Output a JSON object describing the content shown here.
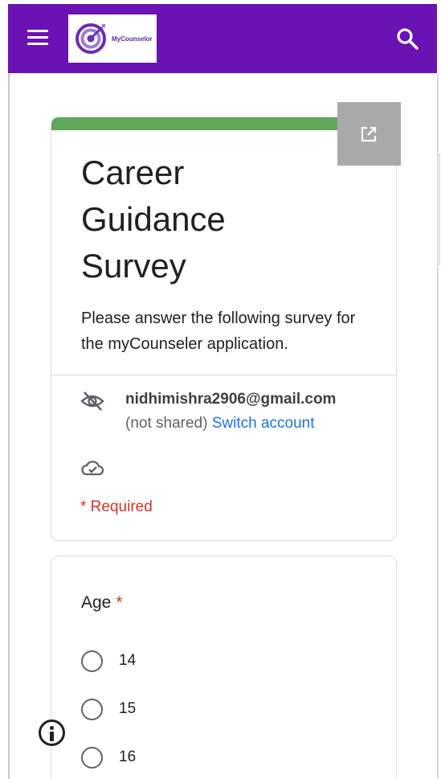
{
  "appbar": {
    "logo_text": "MyCounselor",
    "color": "#6a12b3"
  },
  "form": {
    "title": "Career Guidance Survey",
    "description": "Please answer the following survey for the myCounseler application.",
    "account_email": "nidhimishra2906@gmail.com",
    "not_shared": "(not shared)",
    "switch_account": "Switch account",
    "required_note": "* Required",
    "accent_color": "#5fa85a"
  },
  "question": {
    "label": "Age",
    "required_star": "*",
    "options": [
      "14",
      "15",
      "16"
    ]
  },
  "icons": {
    "menu": "menu-icon",
    "search": "search-icon",
    "popout": "open-in-new-icon",
    "visibility": "visibility-off-icon",
    "cloud": "cloud-done-icon",
    "info": "info-icon"
  }
}
